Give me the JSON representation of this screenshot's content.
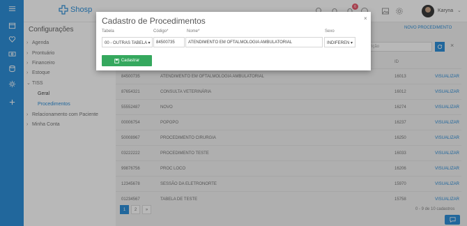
{
  "app": {
    "logo_text": "Shosp",
    "user_name": "Karyna"
  },
  "topbar": {
    "notification_count": "6"
  },
  "sidebar": {
    "title": "Configurações",
    "items": [
      {
        "label": "Agenda"
      },
      {
        "label": "Prontuário"
      },
      {
        "label": "Financeiro"
      },
      {
        "label": "Estoque"
      },
      {
        "label": "TISS"
      }
    ],
    "tiss_sub": {
      "geral": "Geral",
      "procedimentos": "Procedimentos"
    },
    "extra": [
      {
        "label": "Relacionamento com Paciente"
      },
      {
        "label": "Minha Conta"
      }
    ]
  },
  "main": {
    "novo_label": "NOVO PROCEDIMENTO",
    "search_placeholder": "rição",
    "id_header": "ID",
    "link_label": "VISUALIZAR",
    "rows": [
      {
        "code": "84500735",
        "name": "ATENDIMENTO EM OFTALMOLOGIA AMBULATORIAL",
        "id": "16013"
      },
      {
        "code": "87654321",
        "name": "CONSULTA VETERINÁRIA",
        "id": "16012"
      },
      {
        "code": "55552487",
        "name": "NOVO",
        "id": "16274"
      },
      {
        "code": "00006754",
        "name": "POPOPO",
        "id": "16237"
      },
      {
        "code": "50008967",
        "name": "PROCEDIMENTO CIRURGIA",
        "id": "16250"
      },
      {
        "code": "03222222",
        "name": "PROCEDIMENTO TESTE",
        "id": "16033"
      },
      {
        "code": "99876756",
        "name": "PROC LOCO",
        "id": "16206"
      },
      {
        "code": "12345678",
        "name": "SESSÃO DA ELETRONORTE",
        "id": "15970"
      },
      {
        "code": "01234567",
        "name": "TABELA DE TESTE",
        "id": "15758"
      }
    ],
    "pages": [
      "1",
      "2",
      "»"
    ],
    "count_text": "0 - 9 de 10 cadastros"
  },
  "modal": {
    "title": "Cadastro de Procedimentos",
    "labels": {
      "tabela": "Tabela",
      "codigo": "Código*",
      "nome": "Nome*",
      "sexo": "Sexo"
    },
    "values": {
      "tabela": "00 - OUTRAS TABELA ▾",
      "codigo": "84500735",
      "nome": "ATENDIMENTO EM OFTALMOLOGIA AMBULATORIAL",
      "sexo": "INDIFEREN ▾"
    },
    "close": "×",
    "submit_label": "Cadastrar"
  },
  "colors": {
    "brand": "#2f8fd8",
    "success": "#35a85e",
    "badge": "#e95a6e"
  }
}
